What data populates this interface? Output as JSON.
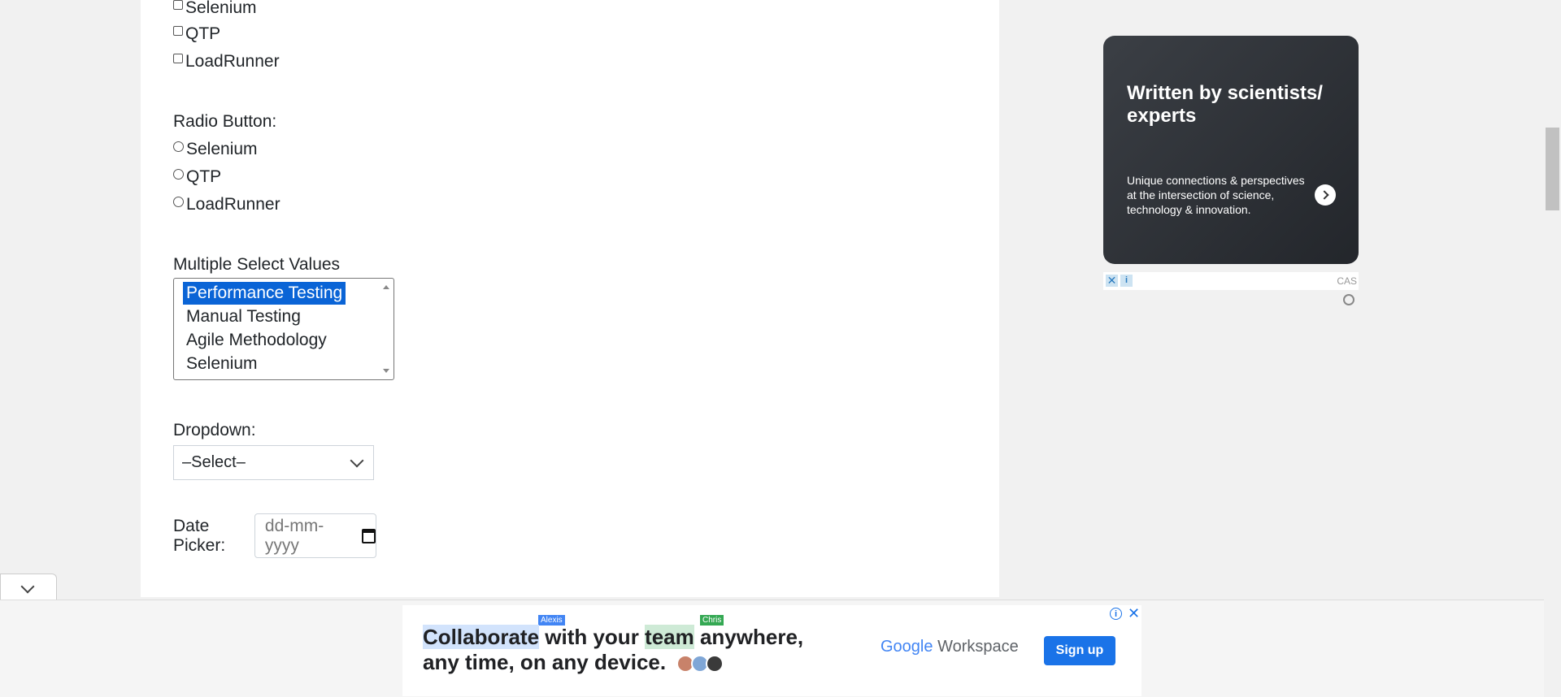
{
  "checkbox_group": {
    "options": [
      "Selenium",
      "QTP",
      "LoadRunner"
    ]
  },
  "radio_group": {
    "label": "Radio Button:",
    "options": [
      "Selenium",
      "QTP",
      "LoadRunner"
    ]
  },
  "multi_select": {
    "label": "Multiple Select Values",
    "options": [
      "Performance Testing",
      "Manual Testing",
      "Agile Methodology",
      "Selenium"
    ],
    "selected": "Performance Testing"
  },
  "dropdown": {
    "label": "Dropdown:",
    "value": "–Select–"
  },
  "date_picker": {
    "label": "Date Picker:",
    "placeholder": "dd-mm-yyyy"
  },
  "side_ad": {
    "title": "Written by scientists/ experts",
    "description": "Unique connections & perspectives at the intersection of science, technology & innovation.",
    "source": "CAS"
  },
  "bottom_ad": {
    "line1_parts": [
      "Collaborate",
      " with your ",
      "team",
      " anywhere,"
    ],
    "line2": "any time, on any device.",
    "tag1": "Alexis",
    "tag2": "Chris",
    "brand_google": "Google",
    "brand_workspace": "Workspace",
    "cta": "Sign up",
    "colors": {
      "cta": "#1a73e8",
      "highlight_blue": "#d2e3fc",
      "highlight_green": "#ceead6"
    }
  },
  "colors": {
    "selected_option": "#0a64d6",
    "ad_card": "#2b2e33"
  }
}
